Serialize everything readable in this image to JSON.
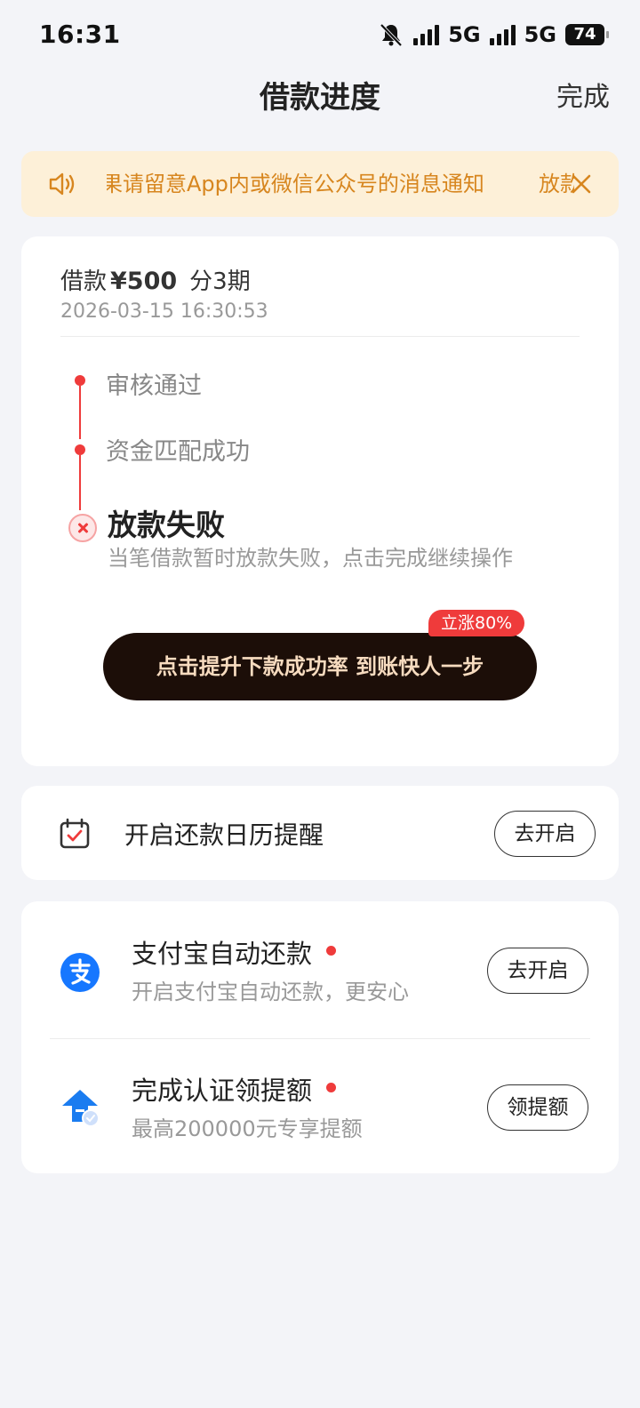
{
  "status_bar": {
    "time": "16:31",
    "network_1": "5G",
    "network_2": "5G",
    "battery": "74",
    "icons": [
      "bell-off-icon",
      "signal-icon",
      "signal-icon",
      "battery-icon"
    ]
  },
  "nav": {
    "title": "借款进度",
    "done": "完成"
  },
  "notice": {
    "text": "果请留意App内或微信公众号的消息通知",
    "tail": "放款",
    "icon": "speaker-icon",
    "close_icon": "close-icon",
    "color": "#d7861f"
  },
  "loan": {
    "prefix": "借款",
    "amount": "¥500",
    "periods": "分3期",
    "datetime": "2026-03-15 16:30:53"
  },
  "timeline": {
    "steps": [
      {
        "label": "审核通过"
      },
      {
        "label": "资金匹配成功"
      }
    ],
    "fail_title": "放款失败",
    "fail_desc": "当笔借款暂时放款失败，点击完成继续操作",
    "accent": "#ef3b3b"
  },
  "boost": {
    "button": "点击提升下款成功率 到账快人一步",
    "badge": "立涨80%"
  },
  "calendar": {
    "label": "开启还款日历提醒",
    "button": "去开启"
  },
  "services": [
    {
      "title": "支付宝自动还款",
      "subtitle": "开启支付宝自动还款，更安心",
      "button": "去开启",
      "icon": "alipay-icon"
    },
    {
      "title": "完成认证领提额",
      "subtitle": "最高200000元专享提额",
      "button": "领提额",
      "icon": "arrow-up-icon"
    }
  ]
}
